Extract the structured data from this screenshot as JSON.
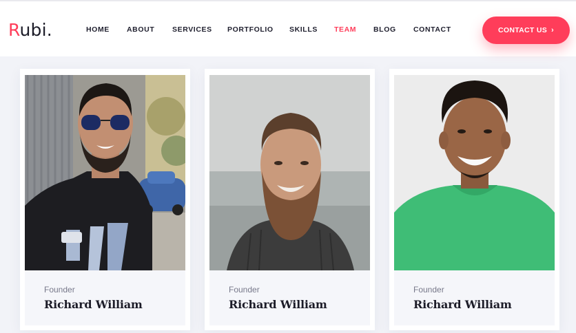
{
  "header": {
    "logo": {
      "text": "Rubi",
      "dot": ".",
      "accent": "#ff3d5a"
    },
    "nav": [
      {
        "label": "HOME",
        "active": false
      },
      {
        "label": "ABOUT",
        "active": false
      },
      {
        "label": "SERVICES",
        "active": false
      },
      {
        "label": "PORTFOLIO",
        "active": false
      },
      {
        "label": "SKILLS",
        "active": false
      },
      {
        "label": "TEAM",
        "active": true
      },
      {
        "label": "BLOG",
        "active": false
      },
      {
        "label": "CONTACT",
        "active": false
      }
    ],
    "cta": {
      "label": "CONTACT US",
      "icon": "chevron-right-icon"
    }
  },
  "team": [
    {
      "role": "Founder",
      "name": "Richard William",
      "photo": "team-member-photo-sunglasses"
    },
    {
      "role": "Founder",
      "name": "Richard William",
      "photo": "team-member-photo-beard"
    },
    {
      "role": "Founder",
      "name": "Richard William",
      "photo": "team-member-photo-green-shirt"
    }
  ],
  "colors": {
    "accent": "#ff3d5a",
    "text_dark": "#1c1c28",
    "text_muted": "#77788a",
    "page_bg": "#f2f3f8"
  }
}
